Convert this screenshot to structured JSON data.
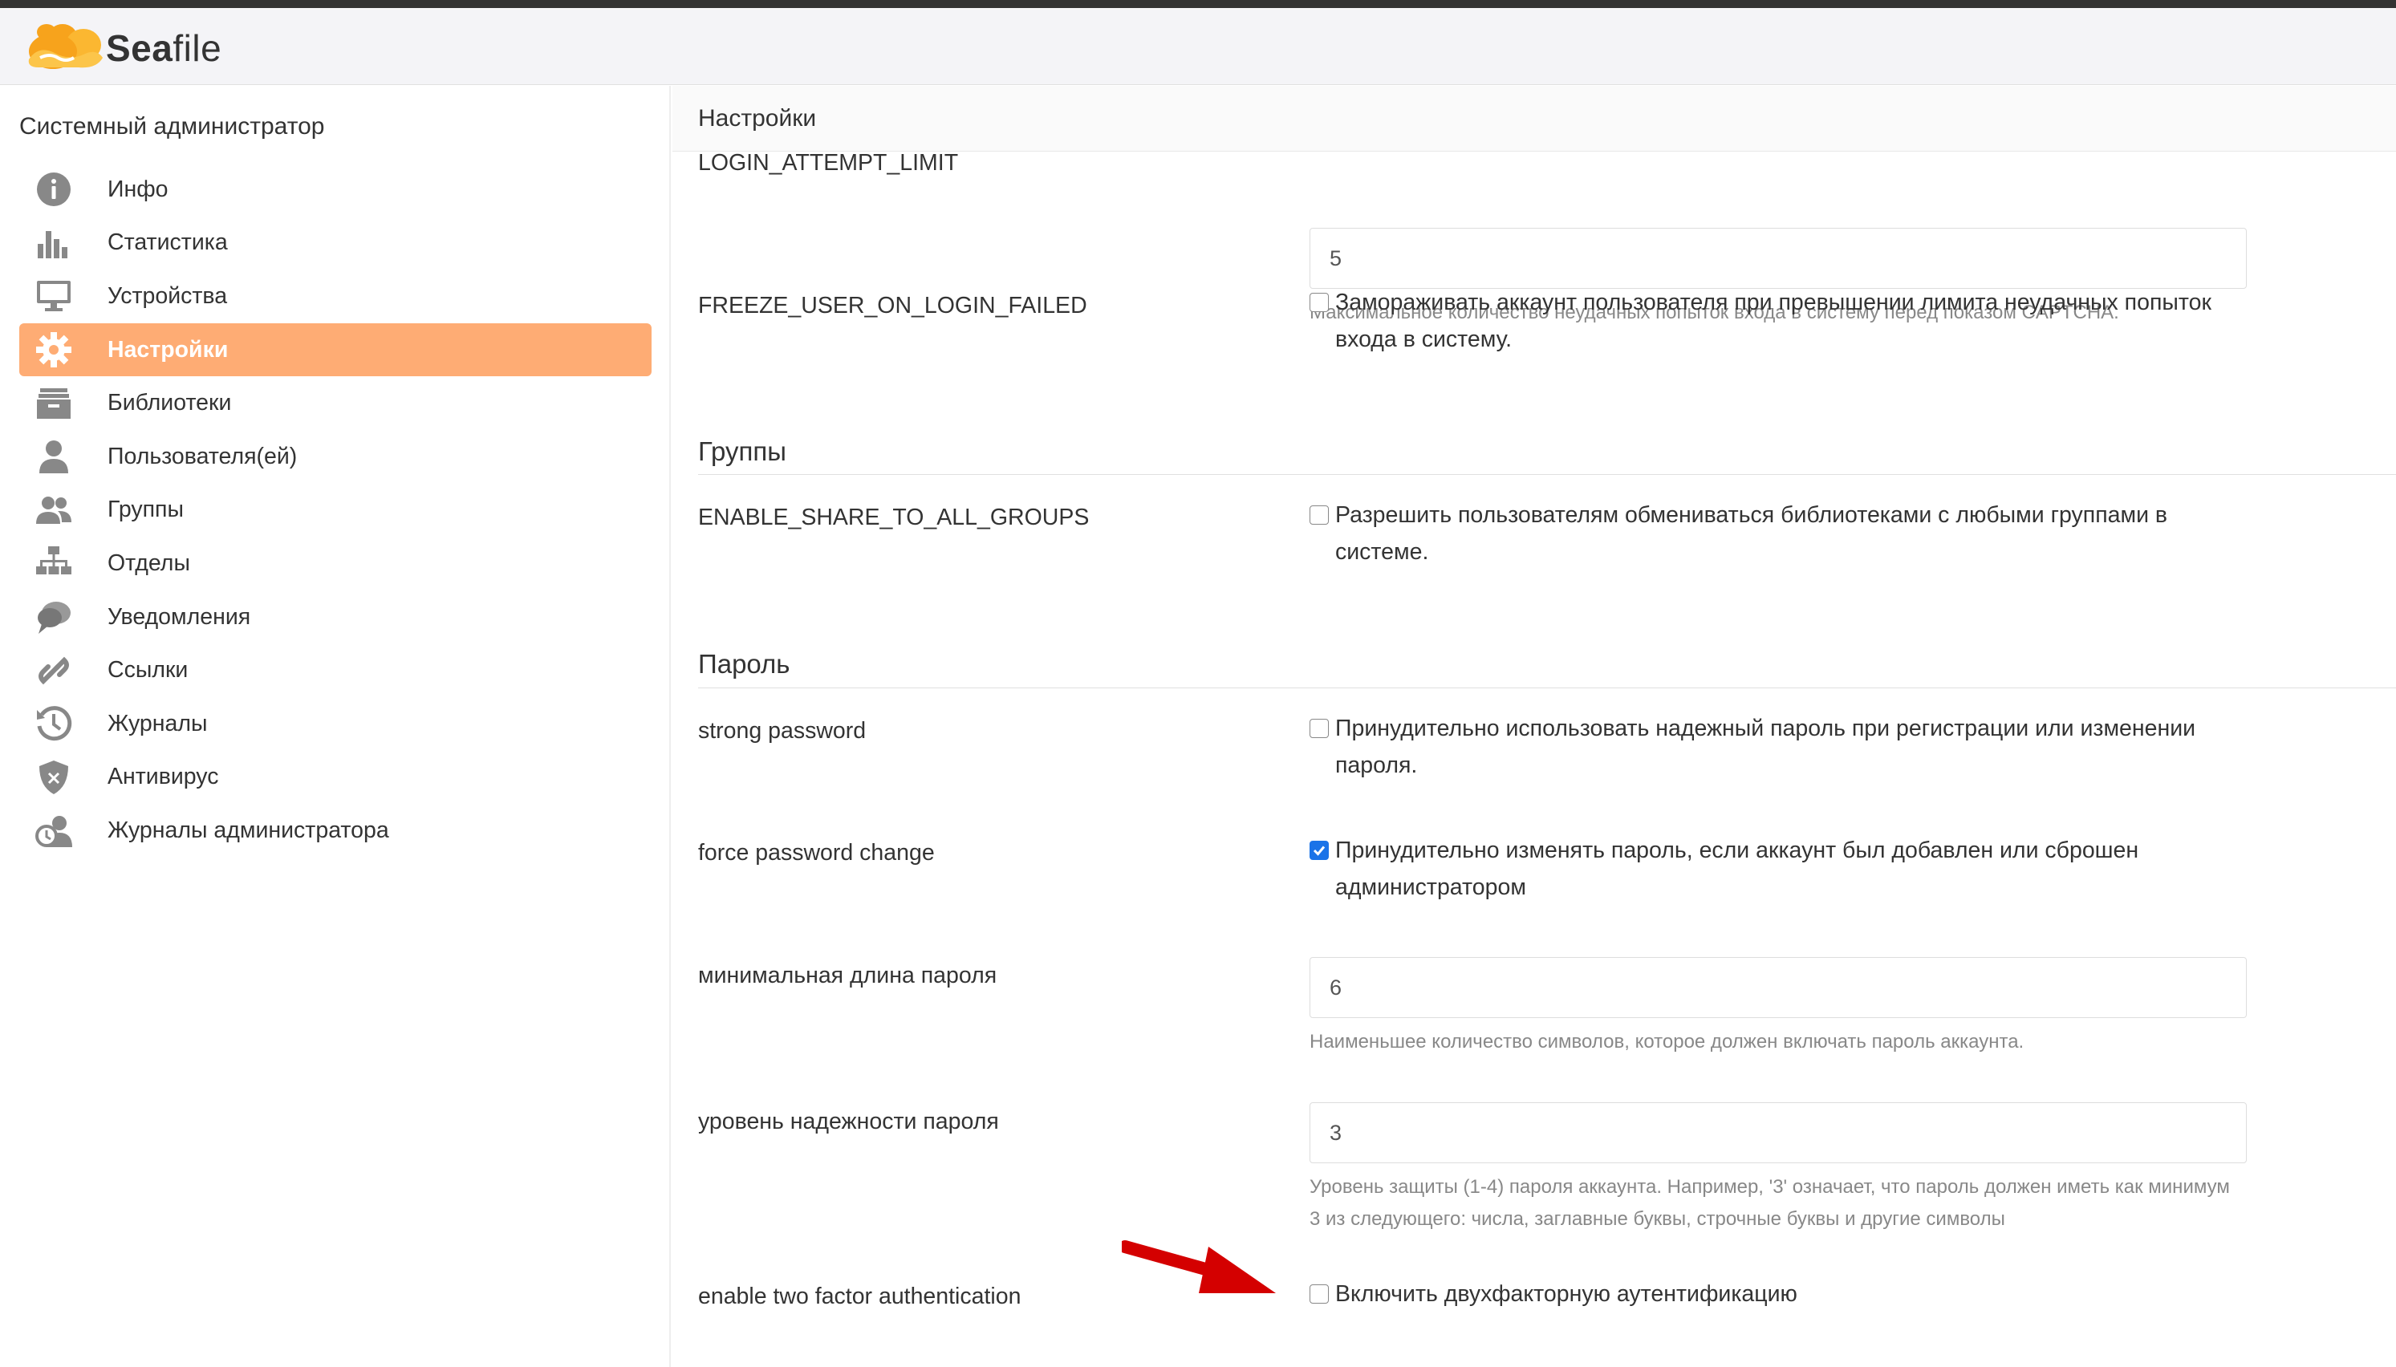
{
  "header": {
    "logo_text_bold": "Sea",
    "logo_text_rest": "file"
  },
  "sidebar": {
    "title": "Системный администратор",
    "items": [
      {
        "label": "Инфо",
        "icon": "info-icon",
        "active": false
      },
      {
        "label": "Статистика",
        "icon": "bar-chart-icon",
        "active": false
      },
      {
        "label": "Устройства",
        "icon": "monitor-icon",
        "active": false
      },
      {
        "label": "Настройки",
        "icon": "gear-icon",
        "active": true
      },
      {
        "label": "Библиотеки",
        "icon": "library-icon",
        "active": false
      },
      {
        "label": "Пользователя(ей)",
        "icon": "user-icon",
        "active": false
      },
      {
        "label": "Группы",
        "icon": "group-icon",
        "active": false
      },
      {
        "label": "Отделы",
        "icon": "org-chart-icon",
        "active": false
      },
      {
        "label": "Уведомления",
        "icon": "chat-bubble-icon",
        "active": false
      },
      {
        "label": "Ссылки",
        "icon": "link-icon",
        "active": false
      },
      {
        "label": "Журналы",
        "icon": "history-icon",
        "active": false
      },
      {
        "label": "Антивирус",
        "icon": "shield-icon",
        "active": false
      },
      {
        "label": "Журналы администратора",
        "icon": "admin-logs-icon",
        "active": false
      }
    ]
  },
  "main": {
    "title": "Настройки",
    "login_attempt": {
      "label": "LOGIN_ATTEMPT_LIMIT",
      "value": "5",
      "help": "Максимальное количество неудачных попыток входа в систему перед показом CAPTCHA."
    },
    "freeze_user": {
      "label": "FREEZE_USER_ON_LOGIN_FAILED",
      "text": "Замораживать аккаунт пользователя при превышении лимита неудачных попыток входа в систему.",
      "checked": false
    },
    "groups_section": {
      "title": "Группы",
      "share_all": {
        "label": "ENABLE_SHARE_TO_ALL_GROUPS",
        "text": "Разрешить пользователям обмениваться библиотеками с любыми группами в системе.",
        "checked": false
      }
    },
    "password_section": {
      "title": "Пароль",
      "strong": {
        "label": "strong password",
        "text": "Принудительно использовать надежный пароль при регистрации или изменении пароля.",
        "checked": false
      },
      "force_change": {
        "label": "force password change",
        "text": "Принудительно изменять пароль, если аккаунт был добавлен или сброшен администратором",
        "checked": true
      },
      "min_length": {
        "label": "минимальная длина пароля",
        "value": "6",
        "help": "Наименьшее количество символов, которое должен включать пароль аккаунта."
      },
      "strength": {
        "label": "уровень надежности пароля",
        "value": "3",
        "help": "Уровень защиты (1-4) пароля аккаунта. Например, '3' означает, что пароль должен иметь как минимум 3 из следующего: числа, заглавные буквы, строчные буквы и другие символы"
      },
      "two_factor": {
        "label": "enable two factor authentication",
        "text": "Включить двухфакторную аутентификацию",
        "checked": false
      }
    }
  },
  "colors": {
    "active_nav_bg": "#feac74",
    "checkbox_checked": "#1a73e8",
    "arrow": "#d40000",
    "logo_orange": "#f7a31c"
  }
}
